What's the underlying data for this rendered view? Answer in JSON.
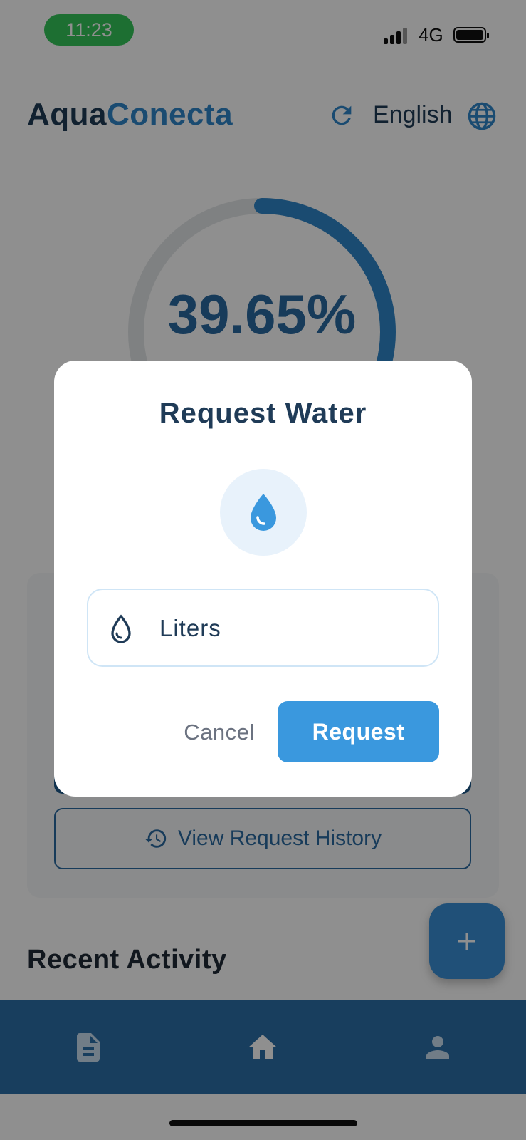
{
  "status_bar": {
    "time": "11:23",
    "network": "4G"
  },
  "header": {
    "brand_part1": "Aqua",
    "brand_part2": "Conecta",
    "language": "English"
  },
  "usage": {
    "percent_label": "39.65%",
    "percent": 39.65
  },
  "card": {
    "history_label": "View Request History"
  },
  "recent_activity": {
    "title": "Recent Activity"
  },
  "dialog": {
    "title": "Request Water",
    "input_placeholder": "Liters",
    "cancel_label": "Cancel",
    "request_label": "Request"
  },
  "bottom_nav": {
    "items": [
      {
        "icon": "document-icon"
      },
      {
        "icon": "home-icon"
      },
      {
        "icon": "person-icon"
      }
    ]
  },
  "colors": {
    "brand_dark": "#1f3b57",
    "brand_accent": "#2f86c9",
    "primary_button": "#3a98de",
    "nav_bar": "#2b6fa8",
    "fab": "#3a8fd6"
  }
}
